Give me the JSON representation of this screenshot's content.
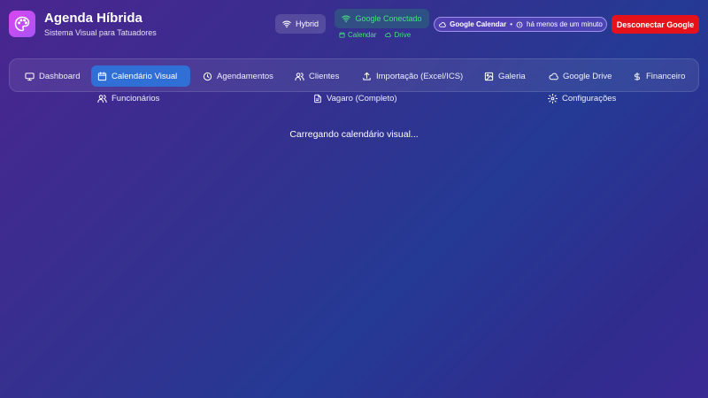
{
  "app": {
    "title": "Agenda Híbrida",
    "subtitle": "Sistema Visual para Tatuadores",
    "logo_icon": "palette-icon",
    "logo_color": "#c44cf0"
  },
  "status": {
    "mode_label": "Hybrid",
    "google_label": "Google Conectado",
    "google_color": "#4ade80",
    "services": [
      "Calendar",
      "Drive"
    ],
    "sync_service": "Google Calendar",
    "sync_separator": "•",
    "sync_time": "há menos de um minuto",
    "disconnect_label": "Desconectar Google",
    "disconnect_color": "#e5121c"
  },
  "nav": {
    "items": [
      {
        "label": "Dashboard",
        "icon": "monitor-icon"
      },
      {
        "label": "Calendário Visual",
        "icon": "calendar-icon",
        "active": true
      },
      {
        "label": "Agendamentos",
        "icon": "clock-icon"
      },
      {
        "label": "Clientes",
        "icon": "users-icon"
      },
      {
        "label": "Importação (Excel/ICS)",
        "icon": "upload-icon"
      },
      {
        "label": "Galeria",
        "icon": "image-icon"
      },
      {
        "label": "Google Drive",
        "icon": "cloud-icon"
      },
      {
        "label": "Financeiro",
        "icon": "dollar-icon"
      },
      {
        "label": "Funcionários",
        "icon": "users-icon"
      },
      {
        "label": "Vagaro (Completo)",
        "icon": "file-icon"
      },
      {
        "label": "Configurações",
        "icon": "settings-icon"
      }
    ],
    "active_color": "#2f6fd6"
  },
  "main": {
    "loading_text": "Carregando calendário visual..."
  }
}
